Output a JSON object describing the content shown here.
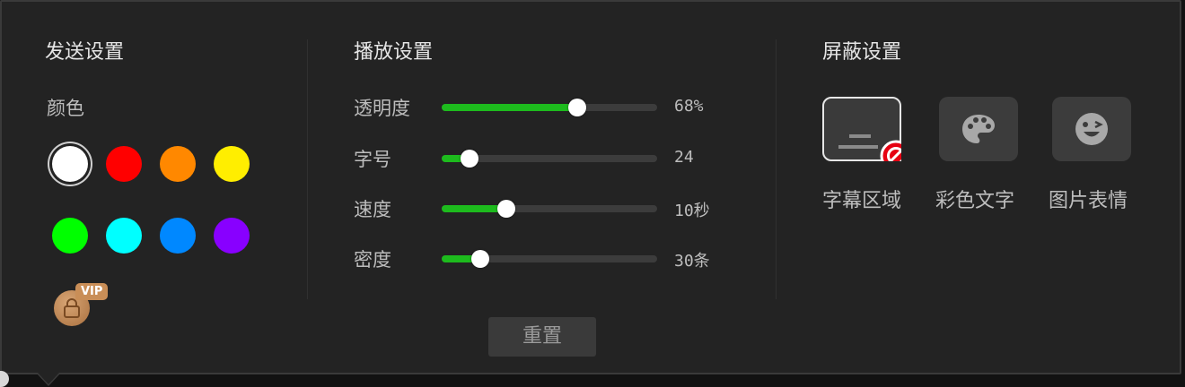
{
  "send": {
    "title": "发送设置",
    "color_label": "颜色",
    "colors": [
      "#ffffff",
      "#ff0000",
      "#ff8800",
      "#ffee00",
      "#00ff00",
      "#00ffff",
      "#0088ff",
      "#8800ff"
    ],
    "selected_color": "#ffffff",
    "vip_badge": "VIP",
    "vip_icon": "lock-icon"
  },
  "play": {
    "title": "播放设置",
    "sliders": [
      {
        "label": "透明度",
        "value_text": "68%",
        "fraction": 0.63
      },
      {
        "label": "字号",
        "value_text": "24",
        "fraction": 0.13
      },
      {
        "label": "速度",
        "value_text": "10秒",
        "fraction": 0.3
      },
      {
        "label": "密度",
        "value_text": "30条",
        "fraction": 0.18
      }
    ],
    "reset_label": "重置"
  },
  "block": {
    "title": "屏蔽设置",
    "options": [
      {
        "label": "字幕区域",
        "icon": "subtitle-area-block-icon",
        "active": true
      },
      {
        "label": "彩色文字",
        "icon": "palette-icon",
        "active": false
      },
      {
        "label": "图片表情",
        "icon": "emoji-icon",
        "active": false
      }
    ]
  },
  "accent_color": "#1dbb1d"
}
